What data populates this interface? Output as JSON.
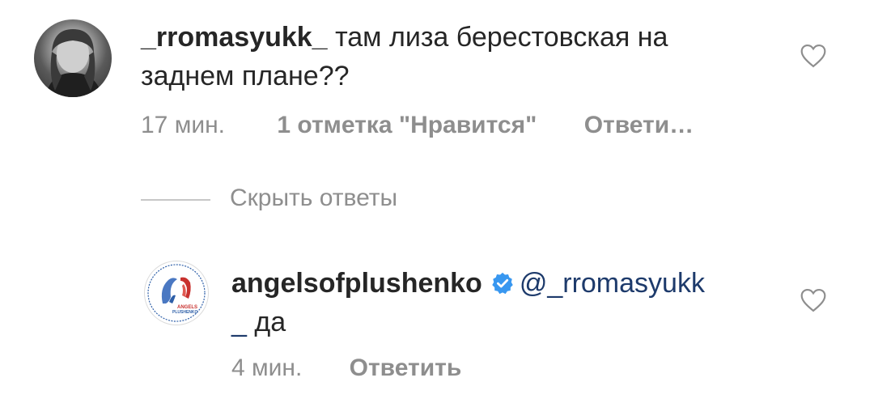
{
  "comments": [
    {
      "username": "_rromasyukk_",
      "text_line1": "там лиза берестовская на",
      "text_line2": "заднем плане??",
      "time": "17 мин.",
      "likes": "1 отметка \"Нравится\"",
      "reply": "Ответи…"
    }
  ],
  "replies_toggle": "Скрыть ответы",
  "replies": [
    {
      "username": "angelsofplushenko",
      "mention": "@_rromasyukk",
      "text_line2_prefix": "_",
      "text_line2": " да",
      "time": "4 мин.",
      "reply": "Ответить",
      "logo_text_top": "ANGELS",
      "logo_text_bottom": "PLUSHENKO"
    }
  ],
  "colors": {
    "verified": "#3897f0",
    "meta": "#8e8e8e",
    "mention": "#1d3a6b"
  }
}
